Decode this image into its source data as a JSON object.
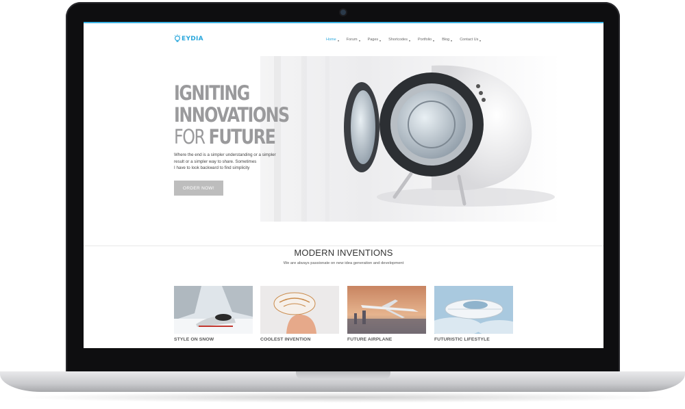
{
  "site": {
    "logo_text": "EYDIA",
    "nav": [
      {
        "label": "Home",
        "active": true
      },
      {
        "label": "Forum",
        "active": false
      },
      {
        "label": "Pages",
        "active": false
      },
      {
        "label": "Shortcodes",
        "active": false
      },
      {
        "label": "Portfolio",
        "active": false
      },
      {
        "label": "Blog",
        "active": false
      },
      {
        "label": "Contact Us",
        "active": false
      }
    ]
  },
  "hero": {
    "title_line1": "IGNITING",
    "title_line2": "INNOVATIONS",
    "title_line3_light": "FOR ",
    "title_line3_bold": "FUTURE",
    "description": [
      "Where the end is a simpler understanding or a simpler",
      "result or a simpler way to share. Sometimes",
      "I have to look backward to find simplicity"
    ],
    "button_label": "ORDER NOW!"
  },
  "section": {
    "title": "MODERN INVENTIONS",
    "subtitle": "We are always passionate on new idea generation and development"
  },
  "cards": [
    {
      "title": "STYLE ON SNOW",
      "icon": "snow-vehicle-image"
    },
    {
      "title": "COOLEST INVENTION",
      "icon": "contact-lens-image"
    },
    {
      "title": "FUTURE AIRPLANE",
      "icon": "airplane-image"
    },
    {
      "title": "FUTURISTIC LIFESTYLE",
      "icon": "airship-image"
    }
  ],
  "colors": {
    "accent": "#2aa7dc",
    "button": "#bdbdbd",
    "title_gray": "#9a9a9c"
  }
}
